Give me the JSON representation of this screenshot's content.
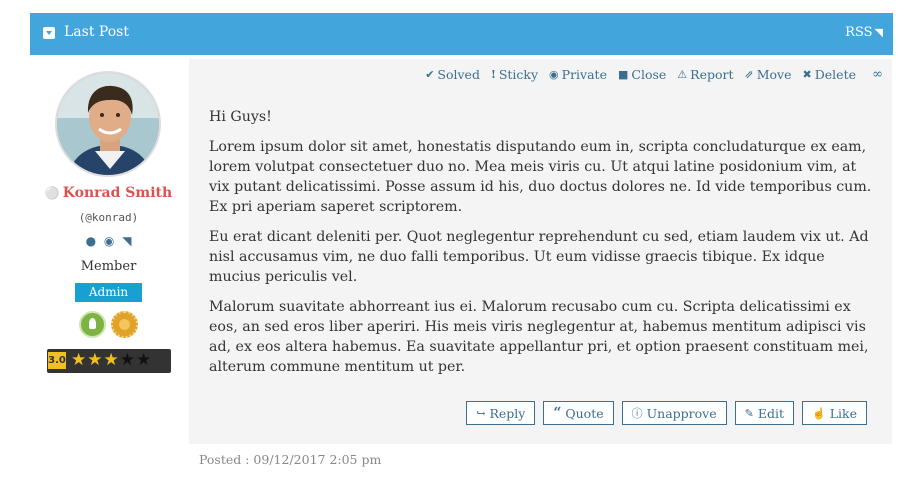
{
  "header": {
    "title": "Last Post",
    "rss_label": "RSS",
    "rss_icon": "◥"
  },
  "user": {
    "name": "Konrad Smith",
    "handle": "(@konrad)",
    "role": "Member",
    "badge": "Admin",
    "rating": "3.0",
    "stars": {
      "filled": 3,
      "total": 5
    },
    "name_color": "#d9534f"
  },
  "toolbar": {
    "solved": "Solved",
    "solved_icon": "✔",
    "sticky": "Sticky",
    "sticky_icon": "!",
    "private": "Private",
    "private_icon": "◉",
    "close": "Close",
    "close_icon": "■",
    "report": "Report",
    "report_icon": "⚠",
    "move": "Move",
    "move_icon": "⇗",
    "delete": "Delete",
    "delete_icon": "✖",
    "link_icon": "∞"
  },
  "post": {
    "greeting": "Hi Guys!",
    "paragraphs": [
      "Lorem ipsum dolor sit amet, honestatis disputando eum in, scripta concludaturque ex eam, lorem volutpat consectetuer duo no. Mea meis viris cu. Ut atqui latine posidonium vim, at vix putant delicatissimi. Posse assum id his, duo doctus dolores ne. Id vide temporibus cum. Ex pri aperiam saperet scriptorem.",
      "Eu erat dicant deleniti per. Quot neglegentur reprehendunt cu sed, etiam laudem vix ut. Ad nisl accusamus vim, ne duo falli temporibus. Ut eum vidisse graecis tibique. Ex idque mucius periculis vel.",
      "Malorum suavitate abhorreant ius ei. Malorum recusabo cum cu. Scripta delicatissimi ex eos, an sed eros liber aperiri. His meis viris neglegentur at, habemus mentitum adipisci vis ad, ex eos altera habemus. Ea suavitate appellantur pri, et option praesent constituam mei, alterum commune mentitum ut per."
    ],
    "posted": "Posted : 09/12/2017 2:05 pm"
  },
  "actions": {
    "reply": "Reply",
    "reply_icon": "↪",
    "quote": "Quote",
    "quote_icon": "“",
    "unapprove": "Unapprove",
    "unapprove_icon": "ⓘ",
    "edit": "Edit",
    "edit_icon": "✎",
    "like": "Like",
    "like_icon": "☝"
  },
  "colors": {
    "header_bg": "#42a6dc",
    "accent": "#3c6e8f",
    "admin_bg": "#16a1d2"
  }
}
